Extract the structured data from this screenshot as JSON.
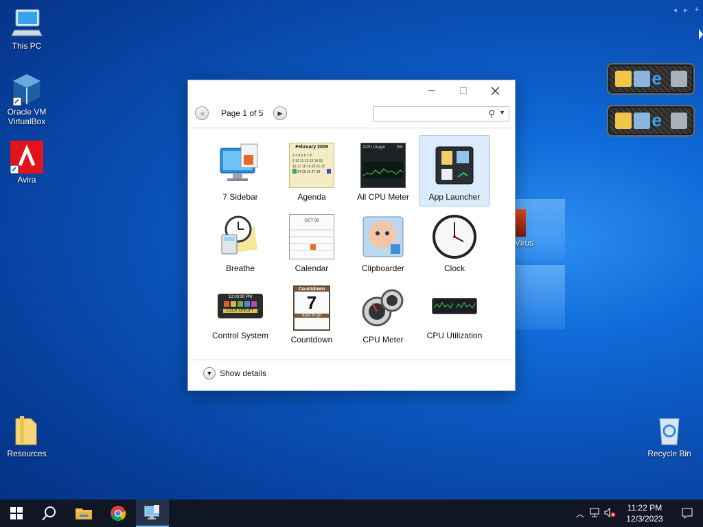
{
  "desktop": {
    "icons": [
      {
        "label": "This PC"
      },
      {
        "label": "Oracle VM VirtualBox"
      },
      {
        "label": "Avira"
      },
      {
        "label": "Resources"
      },
      {
        "label": "Recycle Bin"
      },
      {
        "label": "Virus"
      }
    ],
    "top_strip": {
      "prev": "◂",
      "next": "▸",
      "add": "+"
    }
  },
  "dialog": {
    "page_label": "Page 1 of 5",
    "search_placeholder": "",
    "show_details": "Show details",
    "gadgets": [
      {
        "label": "7 Sidebar",
        "selected": false
      },
      {
        "label": "Agenda",
        "selected": false
      },
      {
        "label": "All CPU Meter",
        "selected": false
      },
      {
        "label": "App Launcher",
        "selected": true
      },
      {
        "label": "Breathe",
        "selected": false
      },
      {
        "label": "Calendar",
        "selected": false
      },
      {
        "label": "Clipboarder",
        "selected": false
      },
      {
        "label": "Clock",
        "selected": false
      },
      {
        "label": "Control System",
        "selected": false
      },
      {
        "label": "Countdown",
        "selected": false
      },
      {
        "label": "CPU Meter",
        "selected": false
      },
      {
        "label": "CPU Utilization",
        "selected": false
      }
    ],
    "thumb_text": {
      "agenda_title": "February 2009",
      "cpu_title": "CPU Usage",
      "cpu_pct": "8%",
      "control_time": "12:03:30 PM",
      "control_lock": "LOCK ON/OFF",
      "calendar_month": "OCT 06",
      "countdown_title": "Countdown",
      "countdown_days": "7",
      "countdown_sub": "days to go"
    }
  },
  "taskbar": {
    "time": "11:22 PM",
    "date": "12/3/2023"
  }
}
